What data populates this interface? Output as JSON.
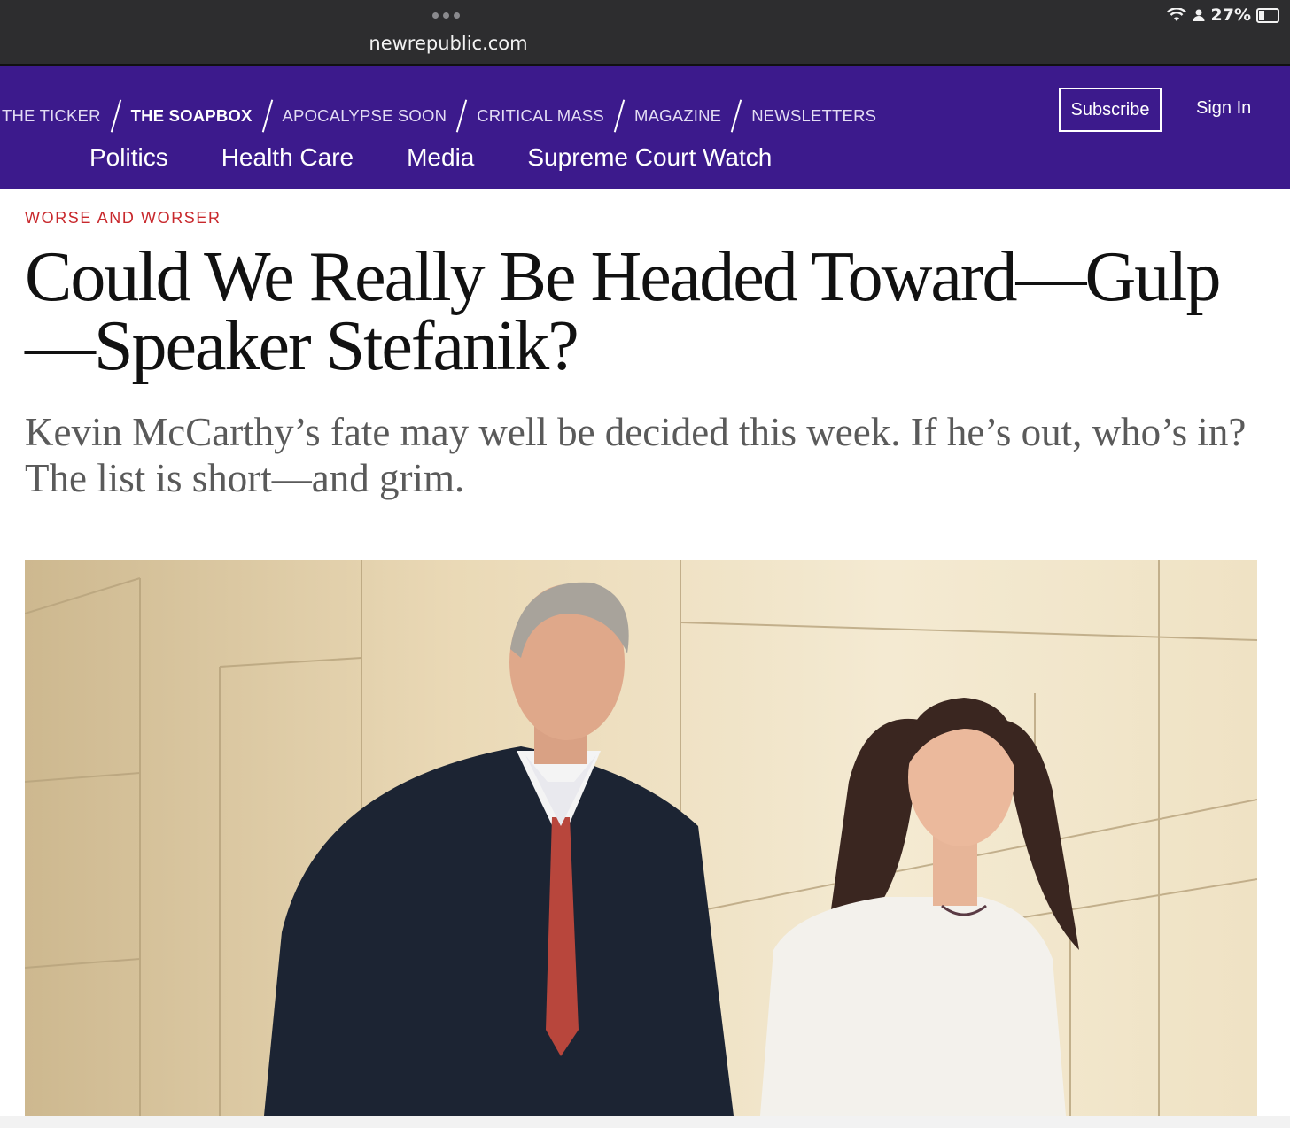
{
  "browser": {
    "url": "newrepublic.com",
    "battery": "27%",
    "battery_level": 0.27
  },
  "nav": {
    "sections": [
      {
        "label": "THE TICKER"
      },
      {
        "label": "THE SOAPBOX"
      },
      {
        "label": "APOCALYPSE SOON"
      },
      {
        "label": "CRITICAL MASS"
      },
      {
        "label": "MAGAZINE"
      },
      {
        "label": "NEWSLETTERS"
      }
    ],
    "subscribe_label": "Subscribe",
    "signin_label": "Sign In",
    "topics": [
      "Politics",
      "Health Care",
      "Media",
      "Supreme Court Watch"
    ]
  },
  "article": {
    "kicker": "WORSE AND WORSER",
    "headline": "Could We Really Be Headed Toward—Gulp—Speaker Stefanik?",
    "dek": "Kevin McCarthy’s fate may well be decided this week. If he’s out, who’s in? The list is short—and grim."
  },
  "colors": {
    "nav_bg": "#3c1a8c",
    "kicker": "#c8282c",
    "chrome_bg": "#2d2d2f"
  }
}
